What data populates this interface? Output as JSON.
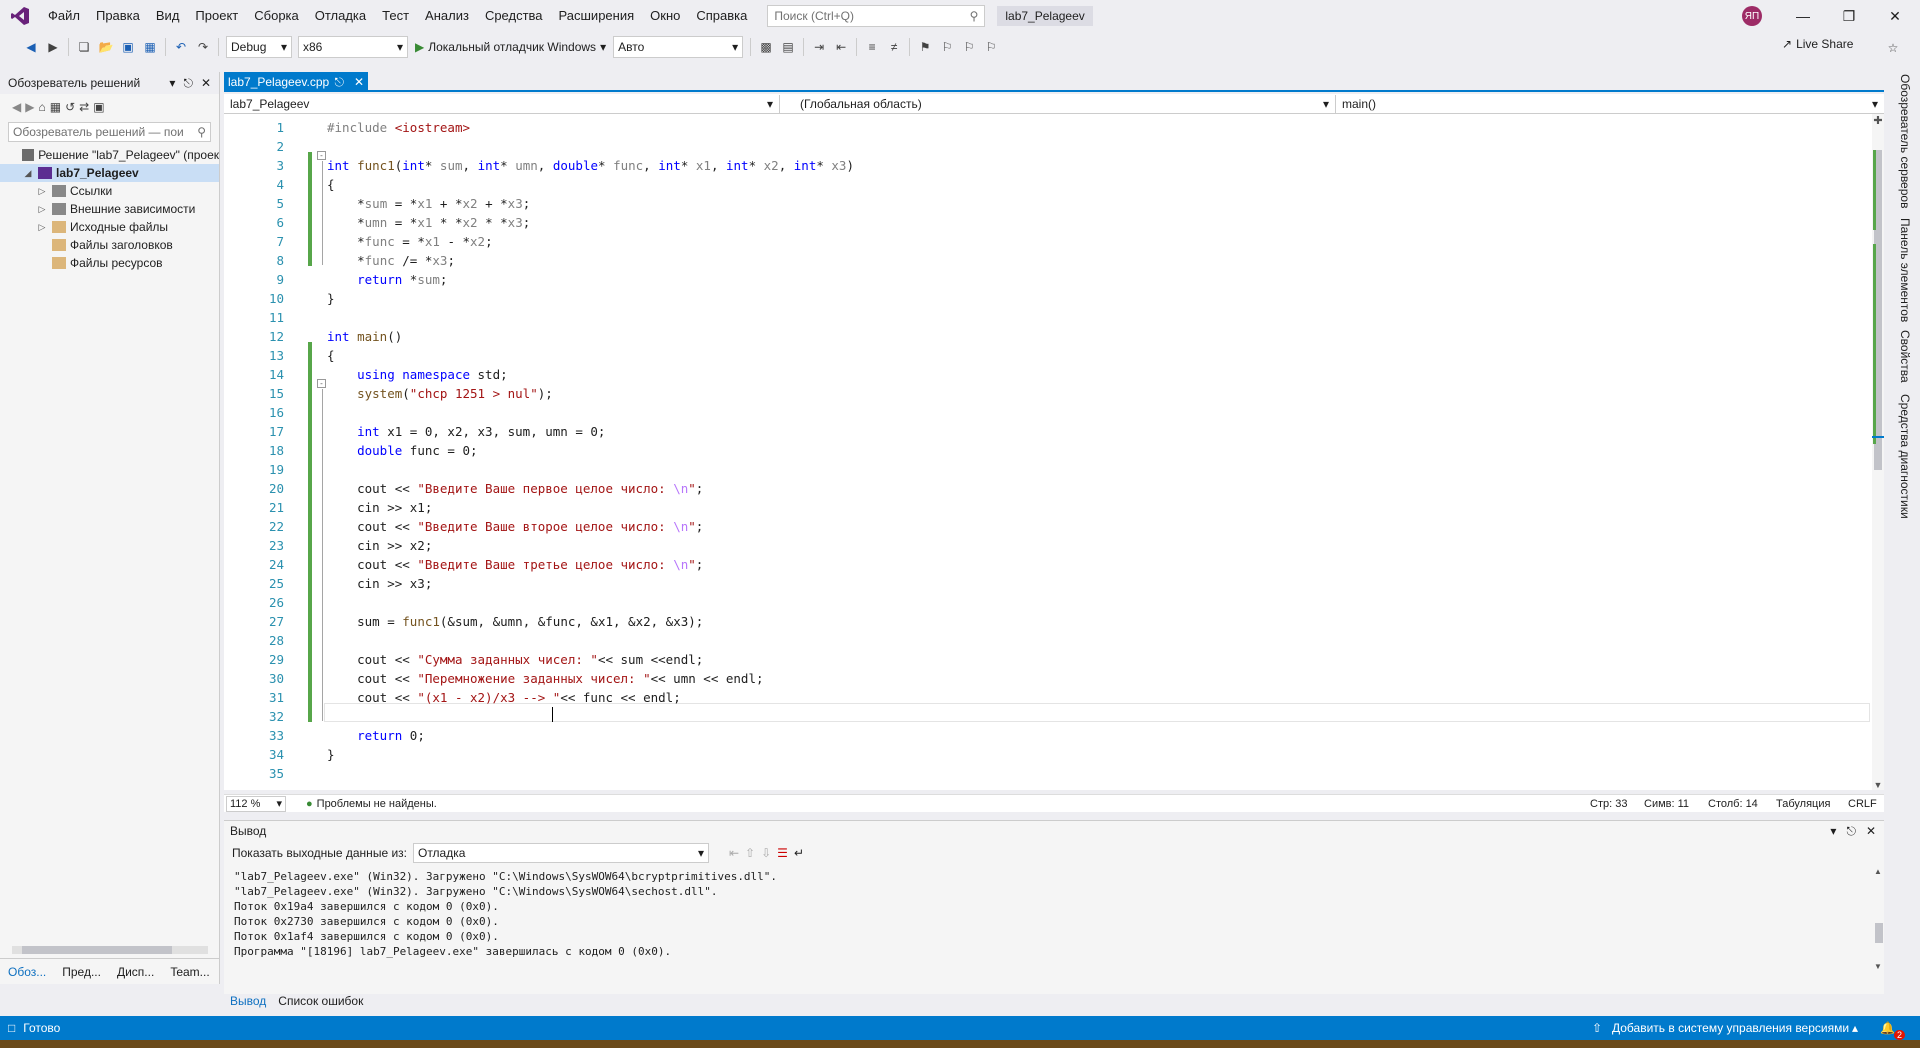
{
  "menu": [
    "Файл",
    "Правка",
    "Вид",
    "Проект",
    "Сборка",
    "Отладка",
    "Тест",
    "Анализ",
    "Средства",
    "Расширения",
    "Окно",
    "Справка"
  ],
  "search": {
    "placeholder": "Поиск (Ctrl+Q)"
  },
  "solution_name": "lab7_Pelageev",
  "user_initials": "ЯП",
  "toolbar": {
    "config": "Debug",
    "platform": "x86",
    "debugger": "Локальный отладчик Windows",
    "mode": "Авто",
    "live_share": "Live Share"
  },
  "solution_explorer": {
    "title": "Обозреватель решений",
    "search_placeholder": "Обозреватель решений — пои",
    "items": [
      {
        "label": "Решение \"lab7_Pelageev\" (проек",
        "indent": 0,
        "arrow": "",
        "selected": false
      },
      {
        "label": "lab7_Pelageev",
        "indent": 1,
        "arrow": "◢",
        "selected": true
      },
      {
        "label": "Ссылки",
        "indent": 2,
        "arrow": "▷",
        "selected": false
      },
      {
        "label": "Внешние зависимости",
        "indent": 2,
        "arrow": "▷",
        "selected": false
      },
      {
        "label": "Исходные файлы",
        "indent": 2,
        "arrow": "▷",
        "selected": false
      },
      {
        "label": "Файлы заголовков",
        "indent": 2,
        "arrow": "",
        "selected": false
      },
      {
        "label": "Файлы ресурсов",
        "indent": 2,
        "arrow": "",
        "selected": false
      }
    ],
    "tabs": [
      "Обоз...",
      "Пред...",
      "Дисп...",
      "Team..."
    ]
  },
  "doc_tab": {
    "label": "lab7_Pelageev.cpp"
  },
  "navbar": {
    "project": "lab7_Pelageev",
    "scope": "(Глобальная область)",
    "member": "main()"
  },
  "code_lines": [
    "<span class=\"pre\">#include</span> <span class=\"str\">&lt;iostream&gt;</span>",
    "",
    "<span class=\"kw\">int</span> <span class=\"fn\">func1</span>(<span class=\"kw\">int</span>* <span class=\"var\">sum</span>, <span class=\"kw\">int</span>* <span class=\"var\">umn</span>, <span class=\"kw\">double</span>* <span class=\"var\">func</span>, <span class=\"kw\">int</span>* <span class=\"var\">x1</span>, <span class=\"kw\">int</span>* <span class=\"var\">x2</span>, <span class=\"kw\">int</span>* <span class=\"var\">x3</span>)",
    "{",
    "    *<span class=\"var\">sum</span> = *<span class=\"var\">x1</span> + *<span class=\"var\">x2</span> + *<span class=\"var\">x3</span>;",
    "    *<span class=\"var\">umn</span> = *<span class=\"var\">x1</span> * *<span class=\"var\">x2</span> * *<span class=\"var\">x3</span>;",
    "    *<span class=\"var\">func</span> = *<span class=\"var\">x1</span> - *<span class=\"var\">x2</span>;",
    "    *<span class=\"var\">func</span> /= *<span class=\"var\">x3</span>;",
    "    <span class=\"kw\">return</span> *<span class=\"var\">sum</span>;",
    "}",
    "",
    "<span class=\"kw\">int</span> <span class=\"fn\">main</span>()",
    "{",
    "    <span class=\"kw\">using namespace</span> std;",
    "    <span class=\"fn\">system</span>(<span class=\"str\">\"chcp 1251 &gt; nul\"</span>);",
    "",
    "    <span class=\"kw\">int</span> x1 = 0, x2, x3, sum, umn = 0;",
    "    <span class=\"kw\">double</span> func = 0;",
    "",
    "    cout &lt;&lt; <span class=\"str\">\"Введите Ваше первое целое число: <span class=\"esc\">\\n</span>\"</span>;",
    "    cin &gt;&gt; x1;",
    "    cout &lt;&lt; <span class=\"str\">\"Введите Ваше второе целое число: <span class=\"esc\">\\n</span>\"</span>;",
    "    cin &gt;&gt; x2;",
    "    cout &lt;&lt; <span class=\"str\">\"Введите Ваше третье целое число: <span class=\"esc\">\\n</span>\"</span>;",
    "    cin &gt;&gt; x3;",
    "",
    "    sum = <span class=\"fn\">func1</span>(&amp;sum, &amp;umn, &amp;func, &amp;x1, &amp;x2, &amp;x3);",
    "",
    "    cout &lt;&lt; <span class=\"str\">\"Сумма заданных чисел: \"</span>&lt;&lt; sum &lt;&lt;endl;",
    "    cout &lt;&lt; <span class=\"str\">\"Перемножение заданных чисел: \"</span>&lt;&lt; umn &lt;&lt; endl;",
    "    cout &lt;&lt; <span class=\"str\">\"(x1 - x2)/x3 --&gt; \"</span>&lt;&lt; func &lt;&lt; endl;",
    "",
    "    <span class=\"kw\">return</span> 0;",
    "}",
    ""
  ],
  "editor_status": {
    "zoom": "112 %",
    "issues": "Проблемы не найдены.",
    "line": "Стр: 33",
    "char": "Симв: 11",
    "col": "Столб: 14",
    "tabs": "Табуляция",
    "eol": "CRLF"
  },
  "right_tabs": [
    "Обозреватель серверов",
    "Панель элементов",
    "Свойства",
    "Средства диагностики"
  ],
  "output": {
    "title": "Вывод",
    "show_label": "Показать выходные данные из:",
    "source": "Отладка",
    "lines": [
      "\"lab7_Pelageev.exe\" (Win32). Загружено \"C:\\Windows\\SysWOW64\\bcryptprimitives.dll\".",
      "\"lab7_Pelageev.exe\" (Win32). Загружено \"C:\\Windows\\SysWOW64\\sechost.dll\".",
      "Поток 0x19a4 завершился с кодом 0 (0x0).",
      "Поток 0x2730 завершился с кодом 0 (0x0).",
      "Поток 0x1af4 завершился с кодом 0 (0x0).",
      "Программа \"[18196] lab7_Pelageev.exe\" завершилась с кодом 0 (0x0)."
    ]
  },
  "bottom_tabs": [
    "Вывод",
    "Список ошибок"
  ],
  "status": {
    "ready": "Готово",
    "vcs": "Добавить в систему управления версиями",
    "notif_count": "2"
  },
  "colors": {
    "accent": "#007acc",
    "keyword": "#0000ff",
    "string": "#a31515",
    "line_number": "#2b91af"
  }
}
